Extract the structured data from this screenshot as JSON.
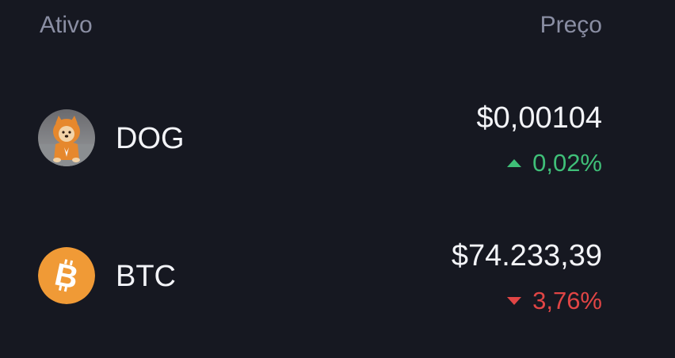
{
  "header": {
    "asset_label": "Ativo",
    "price_label": "Preço"
  },
  "assets": [
    {
      "symbol": "DOG",
      "icon": "dog-avatar-icon",
      "price": "$0,00104",
      "change": "0,02%",
      "direction": "up",
      "change_color": "#3fbf78"
    },
    {
      "symbol": "BTC",
      "icon": "bitcoin-icon",
      "price": "$74.233,39",
      "change": "3,76%",
      "direction": "down",
      "change_color": "#e14545",
      "icon_color": "#f09a36"
    }
  ]
}
